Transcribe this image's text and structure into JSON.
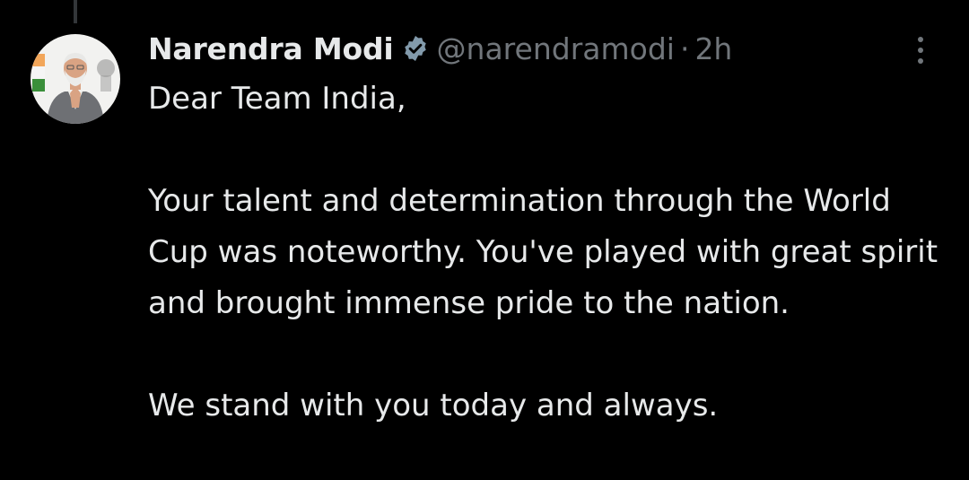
{
  "tweet": {
    "author_name": "Narendra Modi",
    "verified_icon": "verified-badge-icon",
    "handle": "@narendramodi",
    "separator": "·",
    "time": "2h",
    "more_icon": "more-options-icon",
    "paragraphs": [
      "Dear Team India,",
      "Your talent and determination through the World Cup was noteworthy. You've played with great spirit and brought immense pride to the nation.",
      "We stand with you today and always."
    ]
  },
  "colors": {
    "background": "#000000",
    "text_primary": "#e7e9ea",
    "text_secondary": "#71767b",
    "verified_badge": "#829aab"
  }
}
